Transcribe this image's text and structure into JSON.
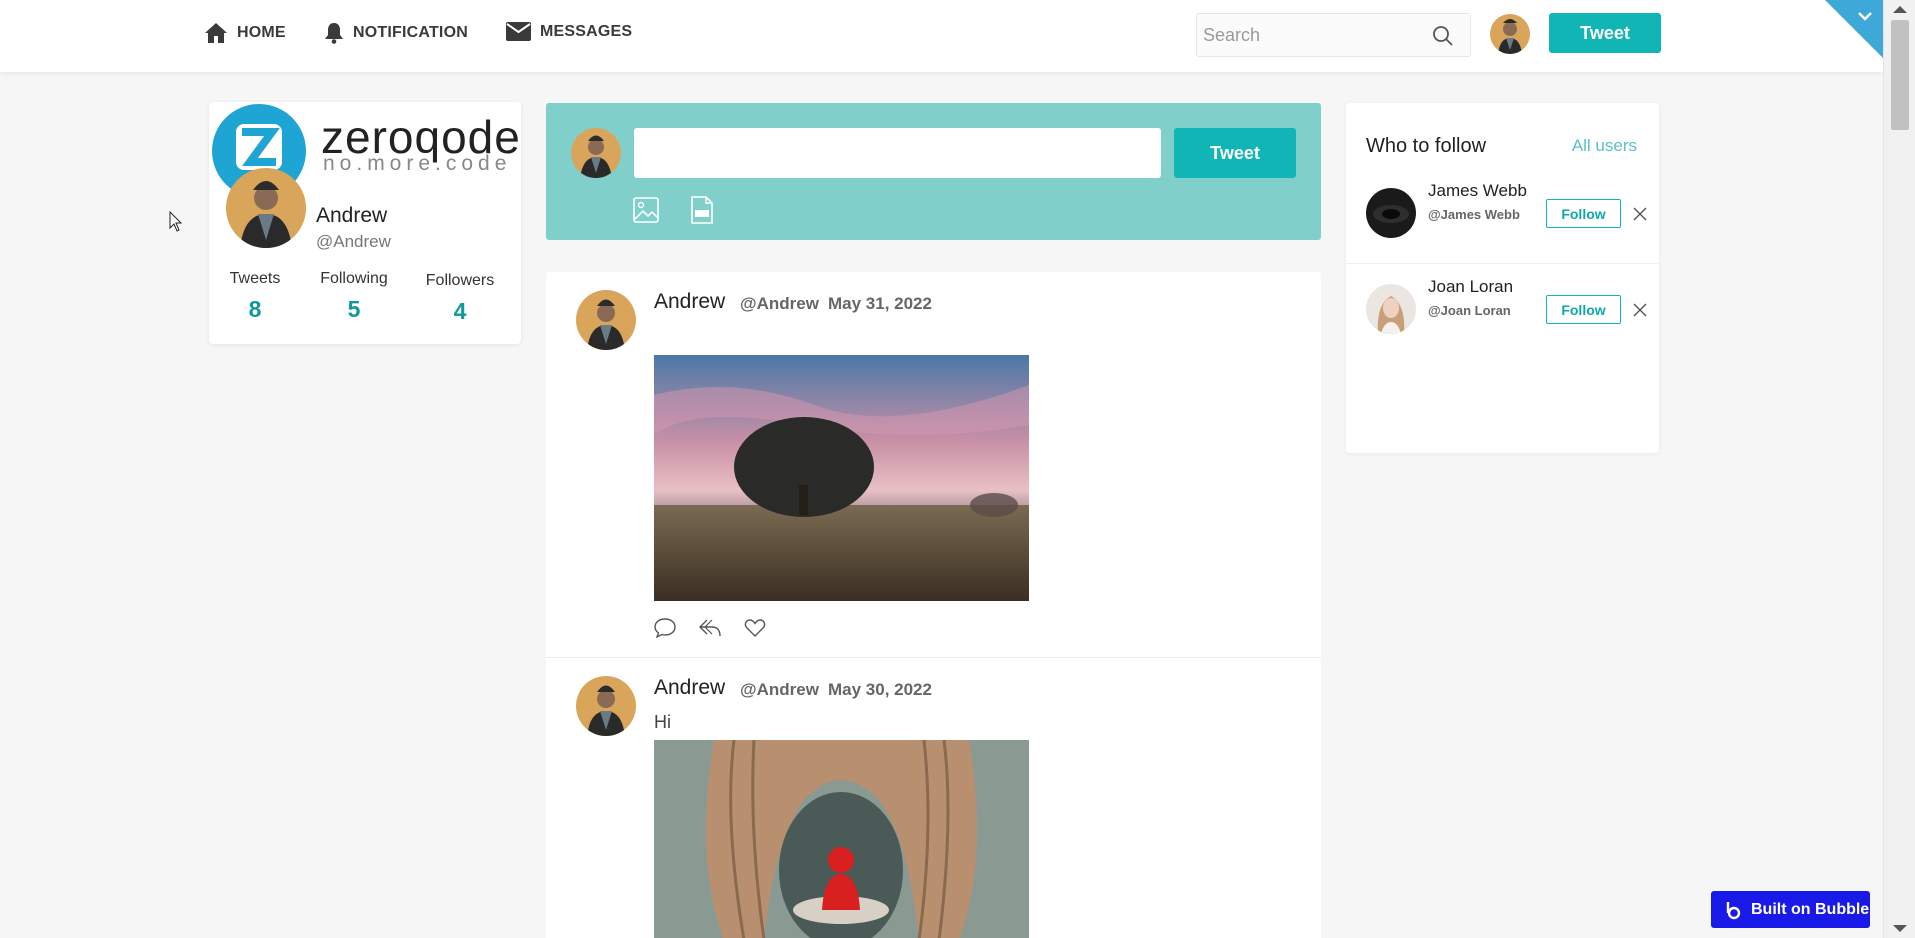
{
  "nav": {
    "home": "HOME",
    "notification": "NOTIFICATION",
    "messages": "MESSAGES",
    "search_placeholder": "Search",
    "tweet_button": "Tweet"
  },
  "profile": {
    "logo_text": "zeroqode",
    "logo_subtext": "no.more.code",
    "name": "Andrew",
    "handle": "@Andrew",
    "stats": [
      {
        "label": "Tweets",
        "value": "8"
      },
      {
        "label": "Following",
        "value": "5"
      },
      {
        "label": "Followers",
        "value": "4"
      }
    ]
  },
  "composer": {
    "input_value": "",
    "tweet_button": "Tweet"
  },
  "posts": [
    {
      "name": "Andrew",
      "handle": "@Andrew",
      "date": "May 31, 2022",
      "text": ""
    },
    {
      "name": "Andrew",
      "handle": "@Andrew",
      "date": "May 30, 2022",
      "text": "Hi"
    }
  ],
  "who_to_follow": {
    "title": "Who to follow",
    "all_users": "All users",
    "users": [
      {
        "name": "James Webb",
        "handle": "@James Webb",
        "button": "Follow"
      },
      {
        "name": "Joan Loran",
        "handle": "@Joan Loran",
        "button": "Follow"
      }
    ]
  },
  "badge": {
    "label": "Built on Bubble"
  },
  "colors": {
    "accent": "#12b5b5",
    "composer_bg": "#80cfca",
    "stat_value": "#12999a",
    "badge": "#1a1ae8"
  }
}
